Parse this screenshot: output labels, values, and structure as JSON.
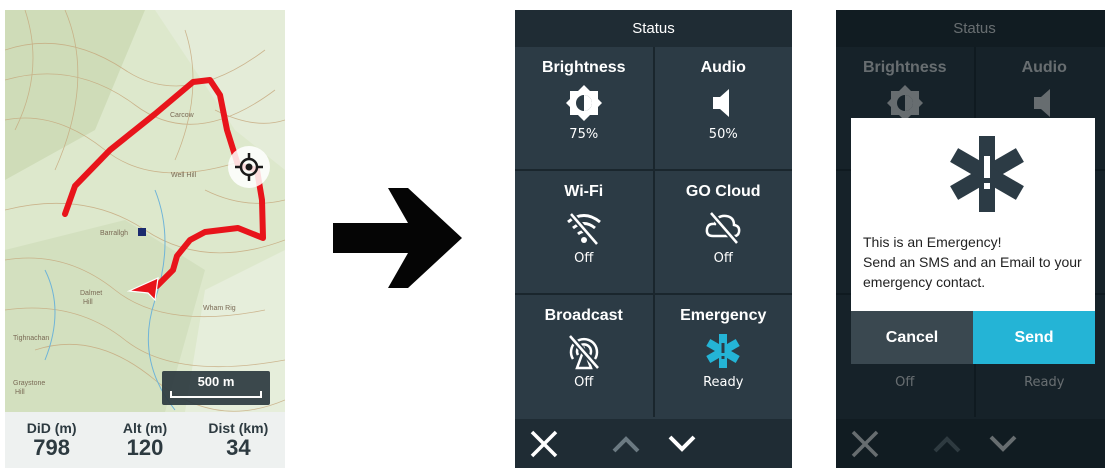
{
  "map": {
    "scale_label": "500 m",
    "stats": [
      {
        "label": "DiD (m)",
        "value": "798"
      },
      {
        "label": "Alt (m)",
        "value": "120"
      },
      {
        "label": "Dist (km)",
        "value": "34"
      }
    ],
    "route_color": "#e8141b"
  },
  "status_screen": {
    "title": "Status",
    "tiles": [
      {
        "name": "Brightness",
        "icon": "brightness-icon",
        "status": "75%"
      },
      {
        "name": "Audio",
        "icon": "volume-icon",
        "status": "50%"
      },
      {
        "name": "Wi-Fi",
        "icon": "wifi-off-icon",
        "status": "Off"
      },
      {
        "name": "GO Cloud",
        "icon": "cloud-off-icon",
        "status": "Off"
      },
      {
        "name": "Broadcast",
        "icon": "broadcast-off-icon",
        "status": "Off"
      },
      {
        "name": "Emergency",
        "icon": "emergency-icon",
        "status": "Ready"
      }
    ],
    "accent": "#24b4d6"
  },
  "emergency_dialog": {
    "message_line1": "This is an Emergency!",
    "message_line2": "Send an SMS and an Email to your emergency contact.",
    "cancel_label": "Cancel",
    "send_label": "Send"
  }
}
